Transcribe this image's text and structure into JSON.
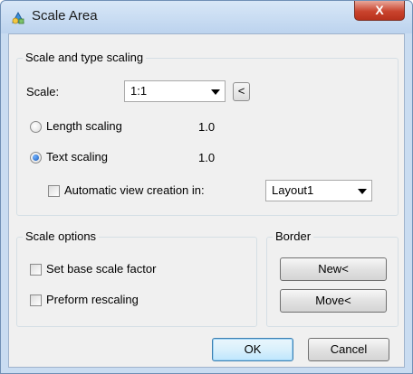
{
  "window": {
    "title": "Scale Area",
    "close_glyph": "X",
    "app_icon": "app-icon"
  },
  "scale_group": {
    "legend": "Scale and type scaling",
    "scale_label": "Scale:",
    "scale_value": "1:1",
    "pick_button": "<",
    "length_scaling_label": "Length scaling",
    "length_scaling_value": "1.0",
    "length_scaling_selected": false,
    "text_scaling_label": "Text scaling",
    "text_scaling_value": "1.0",
    "text_scaling_selected": true,
    "auto_view_label": "Automatic view creation in:",
    "auto_view_checked": false,
    "layout_value": "Layout1"
  },
  "scale_options": {
    "legend": "Scale options",
    "set_base_label": "Set base scale factor",
    "set_base_checked": false,
    "rescaling_label": "Preform rescaling",
    "rescaling_checked": false
  },
  "border": {
    "legend": "Border",
    "new_label": "New<",
    "move_label": "Move<"
  },
  "footer": {
    "ok_label": "OK",
    "cancel_label": "Cancel"
  },
  "colors": {
    "title_bar": "#c9dcf1",
    "close_button": "#c9442e",
    "dialog_bg": "#f0f0f0",
    "radio_selected": "#1c5bb8"
  }
}
